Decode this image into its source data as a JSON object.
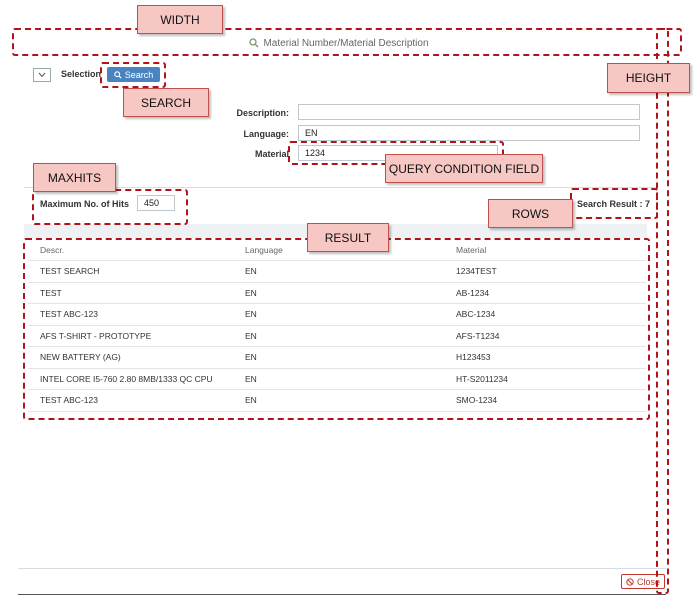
{
  "dialog": {
    "title": "Material Number/Material Description",
    "selection_label": "Selection",
    "search_button": "Search",
    "close_button": "Close"
  },
  "filters": {
    "description": {
      "label": "Description:",
      "value": ""
    },
    "language": {
      "label": "Language:",
      "value": "EN"
    },
    "material": {
      "label": "Material",
      "value": "1234"
    }
  },
  "maxhits": {
    "label": "Maximum No. of Hits",
    "value": "450"
  },
  "result_count": "Search Result : 7",
  "table": {
    "headers": [
      "Descr.",
      "Language",
      "Material"
    ],
    "rows": [
      [
        "TEST SEARCH",
        "EN",
        "1234TEST"
      ],
      [
        "TEST",
        "EN",
        "AB-1234"
      ],
      [
        "TEST ABC-123",
        "EN",
        "ABC-1234"
      ],
      [
        "AFS T-SHIRT - PROTOTYPE",
        "EN",
        "AFS-T1234"
      ],
      [
        "NEW BATTERY (AG)",
        "EN",
        "H123453"
      ],
      [
        "INTEL CORE I5-760 2.80 8MB/1333 QC CPU",
        "EN",
        "HT-S2011234"
      ],
      [
        "TEST ABC-123",
        "EN",
        "SMO-1234"
      ]
    ]
  },
  "annotations": {
    "width": "WIDTH",
    "height": "HEIGHT",
    "search": "SEARCH",
    "maxhits": "MAXHITS",
    "query_condition_field": "QUERY CONDITION FIELD",
    "rows": "ROWS",
    "result": "RESULT"
  },
  "colors": {
    "primary_button": "#4a84c0",
    "reject": "#c0392b",
    "annotation_border": "#b0141a",
    "annotation_fill": "#f6c7c3"
  }
}
